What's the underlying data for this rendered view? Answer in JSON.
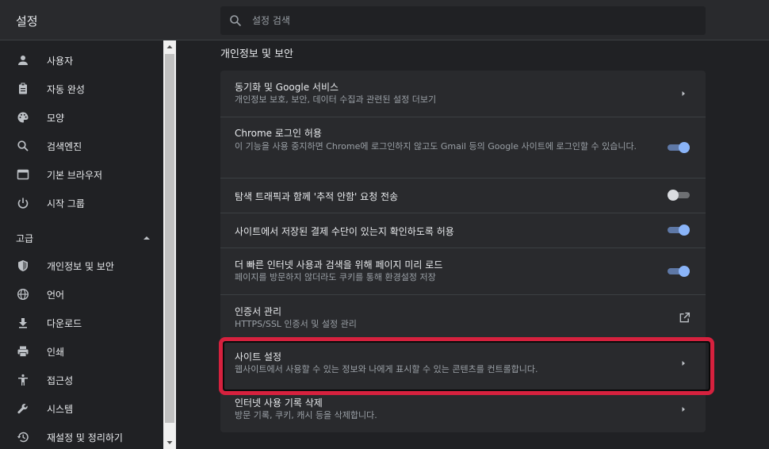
{
  "header": {
    "title": "설정",
    "search_placeholder": "설정 검색"
  },
  "sidebar": {
    "items_top": [
      {
        "label": "사용자",
        "icon": "person-icon"
      },
      {
        "label": "자동 완성",
        "icon": "clipboard-icon"
      },
      {
        "label": "모양",
        "icon": "palette-icon"
      },
      {
        "label": "검색엔진",
        "icon": "search-icon"
      },
      {
        "label": "기본 브라우저",
        "icon": "browser-icon"
      },
      {
        "label": "시작 그룹",
        "icon": "power-icon"
      }
    ],
    "advanced_label": "고급",
    "items_advanced": [
      {
        "label": "개인정보 및 보안",
        "icon": "shield-icon"
      },
      {
        "label": "언어",
        "icon": "globe-icon"
      },
      {
        "label": "다운로드",
        "icon": "download-icon"
      },
      {
        "label": "인쇄",
        "icon": "printer-icon"
      },
      {
        "label": "접근성",
        "icon": "accessibility-icon"
      },
      {
        "label": "시스템",
        "icon": "wrench-icon"
      },
      {
        "label": "재설정 및 정리하기",
        "icon": "history-icon"
      }
    ]
  },
  "main": {
    "section_title": "개인정보 및 보안",
    "rows": [
      {
        "title": "동기화 및 Google 서비스",
        "subtitle": "개인정보 보호, 보안, 데이터 수집과 관련된 설정 더보기",
        "control": "arrow"
      },
      {
        "title": "Chrome 로그인 허용",
        "subtitle": "이 기능을 사용 중지하면 Chrome에 로그인하지 않고도 Gmail 등의 Google 사이트에 로그인할 수 있습니다.",
        "control": "toggle",
        "enabled": true
      },
      {
        "title": "탐색 트래픽과 함께 '추적 안함' 요청 전송",
        "subtitle": "",
        "control": "toggle",
        "enabled": false
      },
      {
        "title": "사이트에서 저장된 결제 수단이 있는지 확인하도록 허용",
        "subtitle": "",
        "control": "toggle",
        "enabled": true
      },
      {
        "title": "더 빠른 인터넷 사용과 검색을 위해 페이지 미리 로드",
        "subtitle": "페이지를 방문하지 않더라도 쿠키를 통해 환경설정 저장",
        "control": "toggle",
        "enabled": true
      },
      {
        "title": "인증서 관리",
        "subtitle": "HTTPS/SSL 인증서 및 설정 관리",
        "control": "external-link"
      },
      {
        "title": "사이트 설정",
        "subtitle": "웹사이트에서 사용할 수 있는 정보와 나에게 표시할 수 있는 콘텐츠를 컨트롤합니다.",
        "control": "arrow",
        "highlighted": true
      },
      {
        "title": "인터넷 사용 기록 삭제",
        "subtitle": "방문 기록, 쿠키, 캐시 등을 삭제합니다.",
        "control": "arrow"
      }
    ]
  },
  "colors": {
    "background": "#202124",
    "card": "#292a2d",
    "accent": "#8ab4f8",
    "highlight": "#d6213e"
  }
}
